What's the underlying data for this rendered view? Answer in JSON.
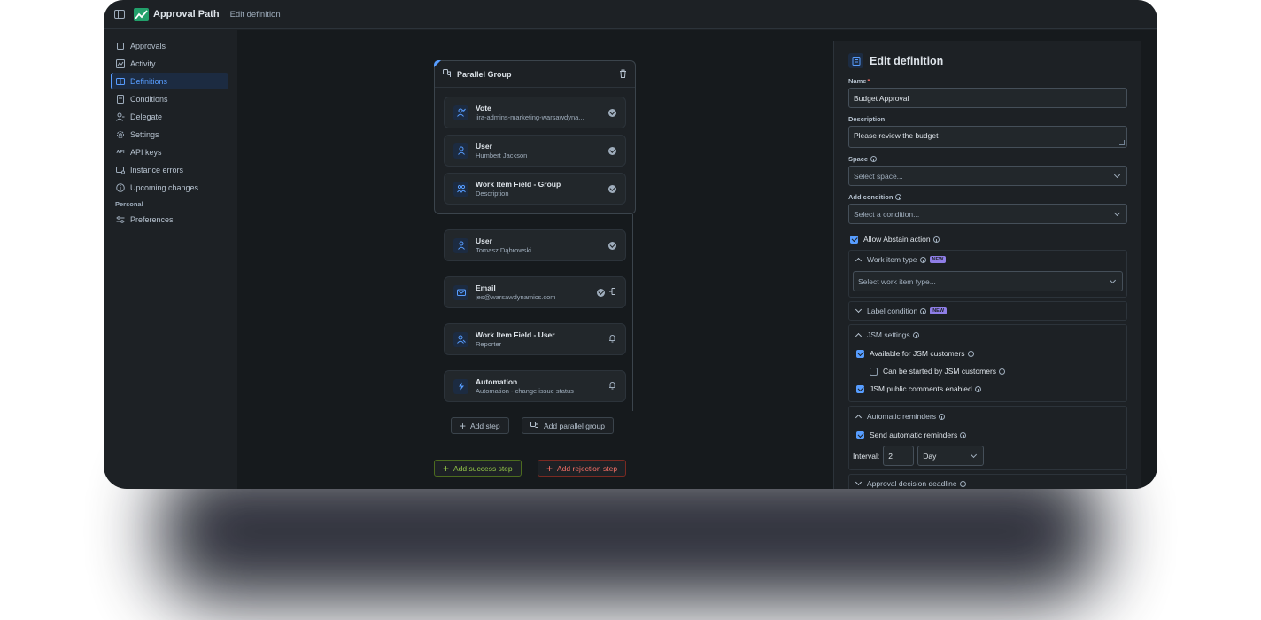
{
  "header": {
    "app_title": "Approval Path",
    "breadcrumb": "Edit definition"
  },
  "sidebar": {
    "items": [
      {
        "label": "Approvals",
        "icon": "approvals-icon"
      },
      {
        "label": "Activity",
        "icon": "activity-icon"
      },
      {
        "label": "Definitions",
        "icon": "definitions-icon",
        "active": true
      },
      {
        "label": "Conditions",
        "icon": "conditions-icon"
      },
      {
        "label": "Delegate",
        "icon": "delegate-icon"
      },
      {
        "label": "Settings",
        "icon": "gear-icon"
      },
      {
        "label": "API keys",
        "icon": "api-icon"
      },
      {
        "label": "Instance errors",
        "icon": "errors-icon"
      },
      {
        "label": "Upcoming changes",
        "icon": "info-icon"
      }
    ],
    "section_personal": "Personal",
    "personal_items": [
      {
        "label": "Preferences",
        "icon": "preferences-icon"
      }
    ]
  },
  "flow": {
    "parallel_group_title": "Parallel Group",
    "group_steps": [
      {
        "title": "Vote",
        "subtitle": "jira-admins-marketing-warsawdyna..."
      },
      {
        "title": "User",
        "subtitle": "Humbert Jackson"
      },
      {
        "title": "Work Item Field - Group",
        "subtitle": "Description"
      }
    ],
    "steps": [
      {
        "title": "User",
        "subtitle": "Tomasz Dąbrowski"
      },
      {
        "title": "Email",
        "subtitle": "jes@warsawdynamics.com"
      },
      {
        "title": "Work Item Field - User",
        "subtitle": "Reporter"
      },
      {
        "title": "Automation",
        "subtitle": "Automation - change issue status"
      }
    ],
    "add_step": "Add step",
    "add_parallel_group": "Add parallel group",
    "add_success_step": "Add success step",
    "add_rejection_step": "Add rejection step"
  },
  "panel": {
    "title": "Edit definition",
    "name_label": "Name",
    "name_required": "*",
    "name_value": "Budget Approval",
    "description_label": "Description",
    "description_value": "Please review the budget",
    "space_label": "Space",
    "space_placeholder": "Select space...",
    "condition_label": "Add condition",
    "condition_placeholder": "Select a condition...",
    "allow_abstain": "Allow Abstain action",
    "work_item_type_label": "Work item type",
    "new_badge": "NEW",
    "work_item_type_placeholder": "Select work item type...",
    "label_condition": "Label condition",
    "jsm_settings": "JSM settings",
    "jsm_available": "Available for JSM customers",
    "jsm_started": "Can be started by JSM customers",
    "jsm_comments": "JSM public comments enabled",
    "auto_reminders": "Automatic reminders",
    "send_reminders": "Send automatic reminders",
    "interval_label": "Interval:",
    "interval_value": "2",
    "interval_unit": "Day",
    "decision_deadline": "Approval decision deadline"
  }
}
